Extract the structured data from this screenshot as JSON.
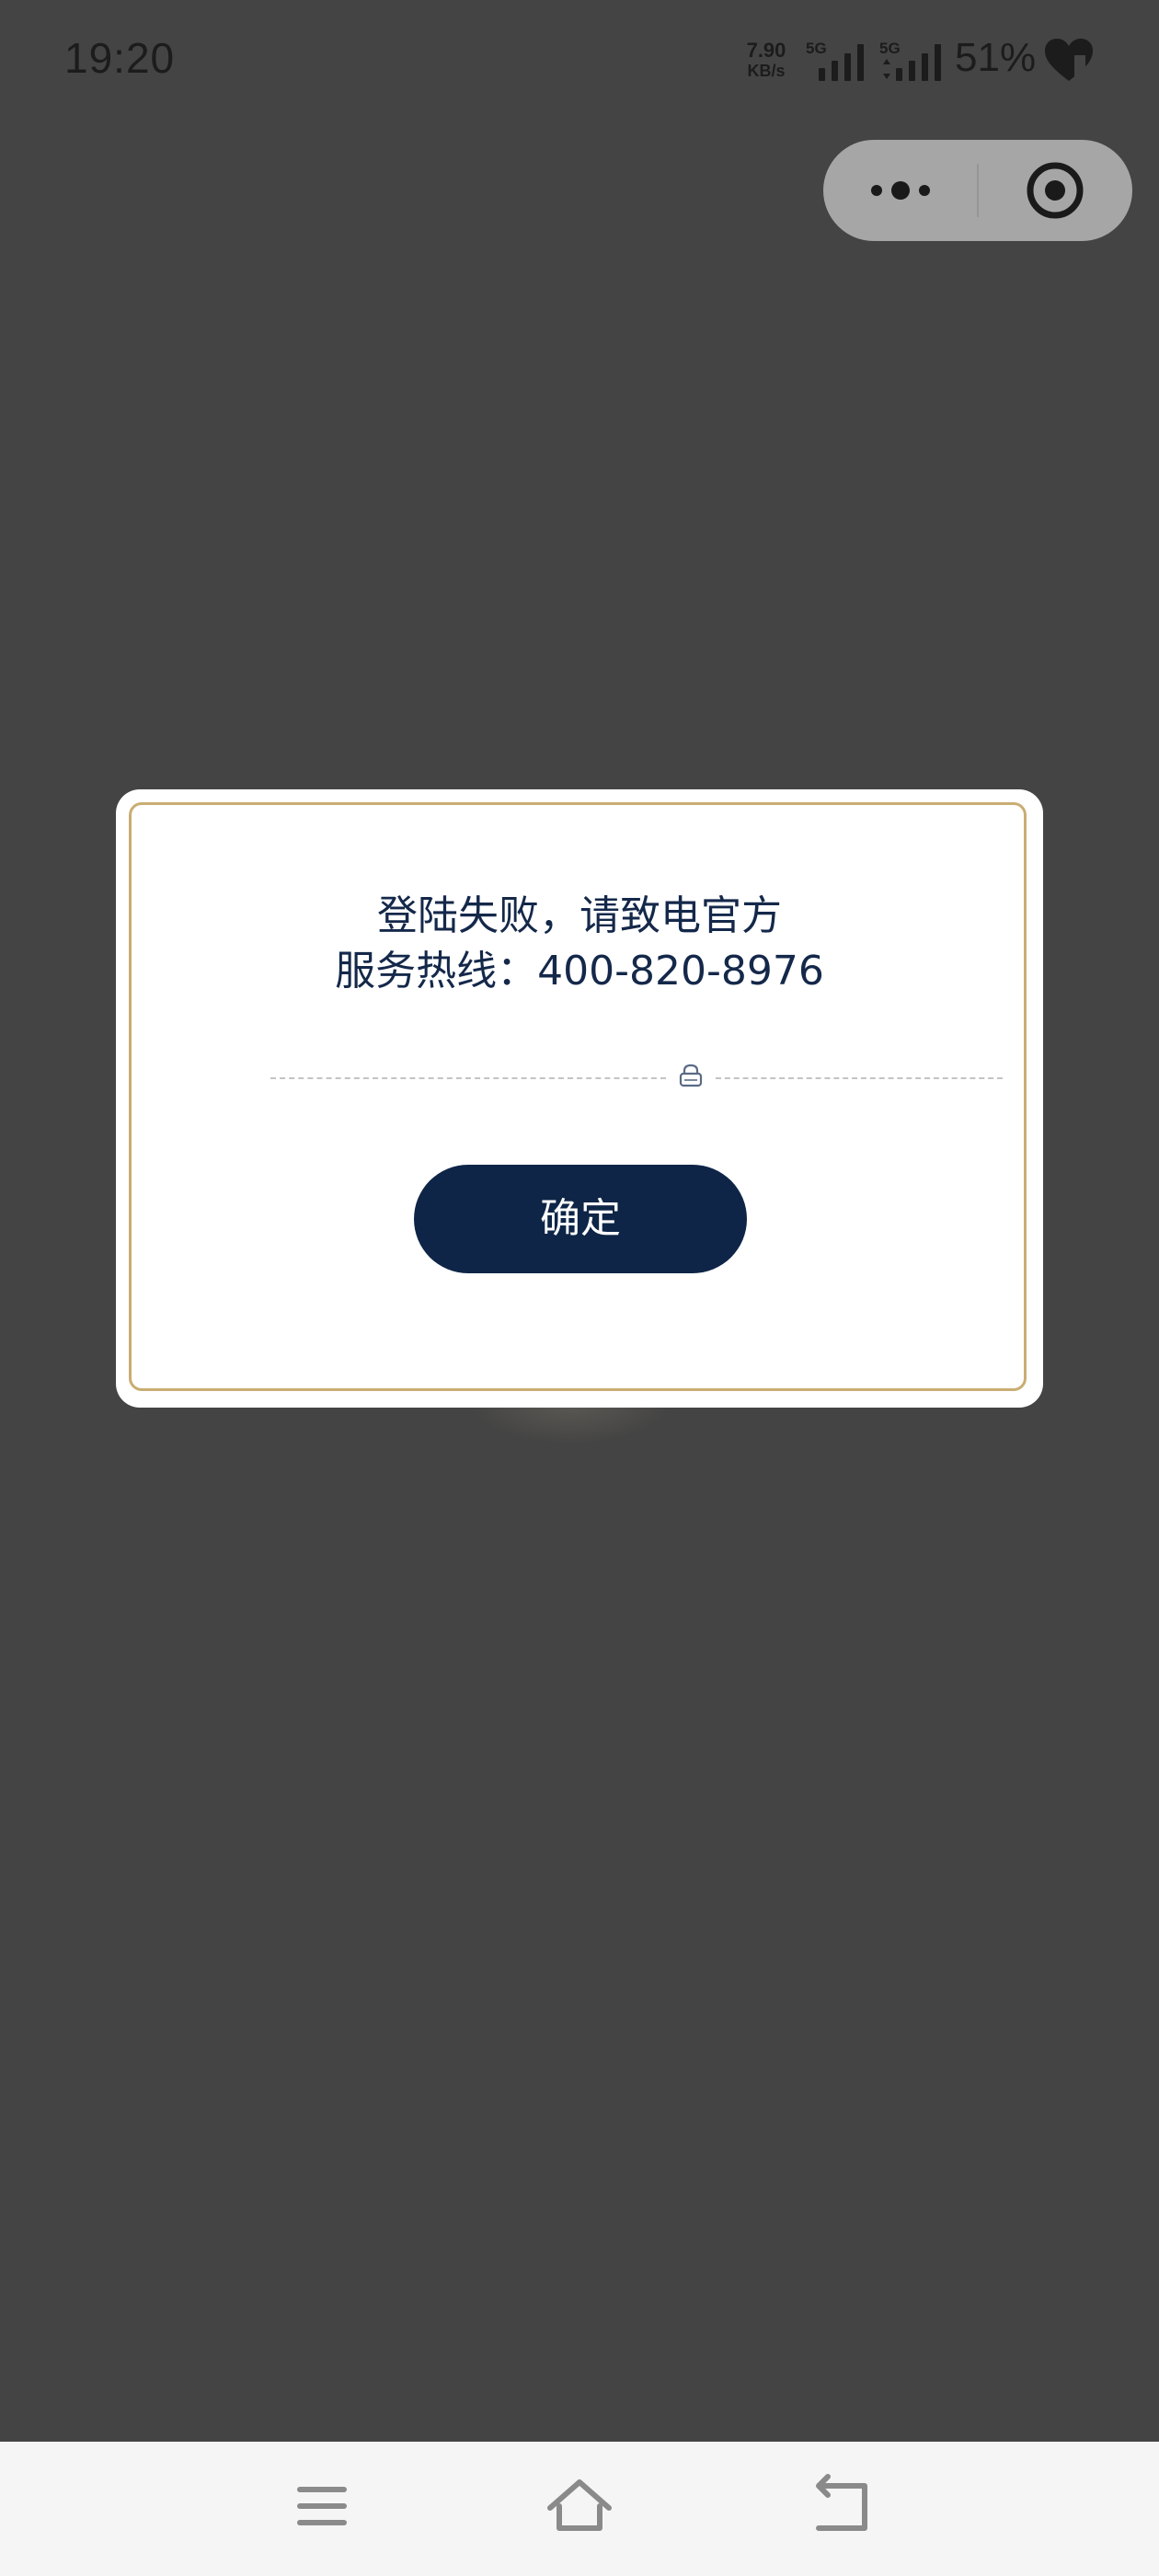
{
  "status_bar": {
    "time": "19:20",
    "net_speed_value": "7.90",
    "net_speed_unit": "KB/s",
    "sim1_label": "5G",
    "sim2_label": "5G",
    "battery": "51%"
  },
  "dialog": {
    "message_line1": "登陆失败，请致电官方",
    "message_line2": "服务热线：400-820-8976",
    "confirm_label": "确定"
  },
  "colors": {
    "overlay": "#444444",
    "dialog_border": "#c9ad72",
    "text_navy": "#14284a",
    "button_navy": "#0e2547",
    "nav_bar": "#f5f5f5"
  },
  "icons": {
    "capsule_more": "more-dots-icon",
    "capsule_close": "target-close-icon",
    "divider_center": "lock-icon",
    "nav_menu": "menu-icon",
    "nav_home": "home-icon",
    "nav_back": "back-icon",
    "status_heart": "heart-icon"
  }
}
